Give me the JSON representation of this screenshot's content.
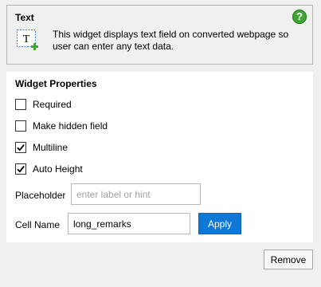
{
  "widget": {
    "title": "Text",
    "help_icon": "?",
    "icon_name": "text-field-widget-icon",
    "icon_glyph": "T",
    "description": "This widget displays text field on converted webpage so user can enter any text data."
  },
  "properties": {
    "title": "Widget Properties",
    "required_label": "Required",
    "required_checked": false,
    "hidden_label": "Make hidden field",
    "hidden_checked": false,
    "multiline_label": "Multiline",
    "multiline_checked": true,
    "autoheight_label": "Auto Height",
    "autoheight_checked": true,
    "placeholder_label": "Placeholder",
    "placeholder_value": "",
    "placeholder_hint": "enter label or hint",
    "cellname_label": "Cell Name",
    "cellname_value": "long_remarks",
    "apply_label": "Apply"
  },
  "footer": {
    "remove_label": "Remove"
  },
  "colors": {
    "accent": "#0f77d6",
    "help_green": "#3fa535",
    "plus_green": "#3fa535"
  }
}
